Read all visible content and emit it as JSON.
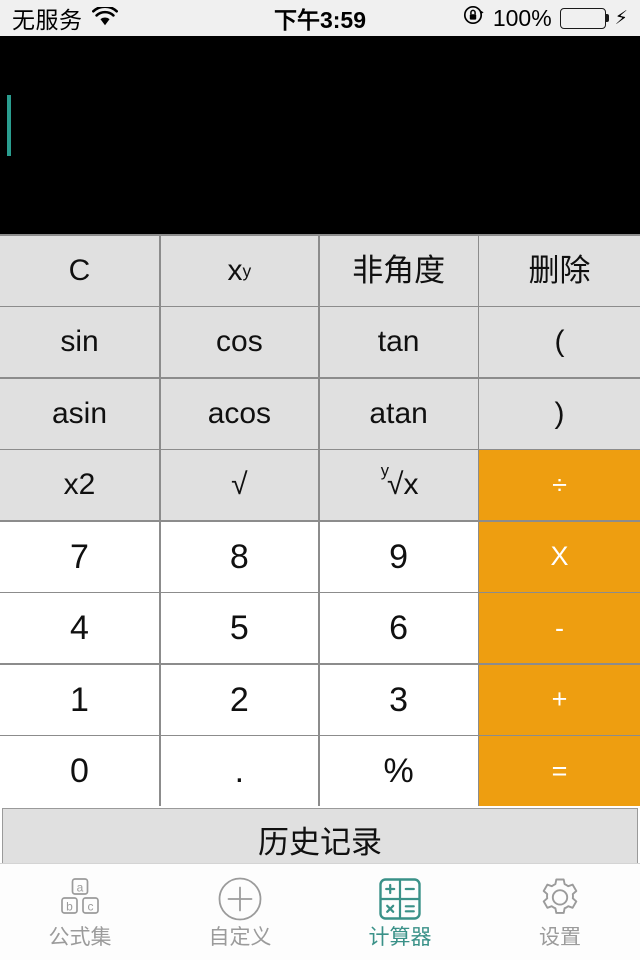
{
  "status_bar": {
    "carrier": "无服务",
    "wifi_icon": "wifi-icon",
    "time": "下午3:59",
    "rotation_lock_icon": "rotation-lock-icon",
    "battery_percent": "100%",
    "battery_icon": "battery-icon",
    "charging_icon": "lightning-bolt-icon",
    "battery_color": "#4cd964"
  },
  "display": {
    "value": "",
    "caret_color": "#2a9d8f",
    "background": "#000000"
  },
  "keypad": {
    "function_key_color": "#e0e0e0",
    "number_key_color": "#ffffff",
    "operator_key_color": "#ee9e10",
    "rows": [
      [
        {
          "label": "C",
          "name": "clear",
          "type": "fn"
        },
        {
          "label": "x",
          "sup": "y",
          "name": "power",
          "type": "fn"
        },
        {
          "label": "非角度",
          "name": "angle-mode",
          "type": "cjk"
        },
        {
          "label": "删除",
          "name": "delete",
          "type": "cjk"
        }
      ],
      [
        {
          "label": "sin",
          "name": "sin",
          "type": "fn"
        },
        {
          "label": "cos",
          "name": "cos",
          "type": "fn"
        },
        {
          "label": "tan",
          "name": "tan",
          "type": "fn"
        },
        {
          "label": "(",
          "name": "open-paren",
          "type": "fn"
        }
      ],
      [
        {
          "label": "asin",
          "name": "asin",
          "type": "fn"
        },
        {
          "label": "acos",
          "name": "acos",
          "type": "fn"
        },
        {
          "label": "atan",
          "name": "atan",
          "type": "fn"
        },
        {
          "label": ")",
          "name": "close-paren",
          "type": "fn"
        }
      ],
      [
        {
          "label": "x2",
          "name": "square",
          "type": "fn"
        },
        {
          "label": "√",
          "name": "square-root",
          "type": "fn"
        },
        {
          "label": "√x",
          "radix": "y",
          "name": "nth-root",
          "type": "fn"
        },
        {
          "label": "÷",
          "name": "divide",
          "type": "op"
        }
      ],
      [
        {
          "label": "7",
          "name": "digit-7",
          "type": "num"
        },
        {
          "label": "8",
          "name": "digit-8",
          "type": "num"
        },
        {
          "label": "9",
          "name": "digit-9",
          "type": "num"
        },
        {
          "label": "X",
          "name": "multiply",
          "type": "op"
        }
      ],
      [
        {
          "label": "4",
          "name": "digit-4",
          "type": "num"
        },
        {
          "label": "5",
          "name": "digit-5",
          "type": "num"
        },
        {
          "label": "6",
          "name": "digit-6",
          "type": "num"
        },
        {
          "label": "-",
          "name": "subtract",
          "type": "op"
        }
      ],
      [
        {
          "label": "1",
          "name": "digit-1",
          "type": "num"
        },
        {
          "label": "2",
          "name": "digit-2",
          "type": "num"
        },
        {
          "label": "3",
          "name": "digit-3",
          "type": "num"
        },
        {
          "label": "+",
          "name": "add",
          "type": "op"
        }
      ],
      [
        {
          "label": "0",
          "name": "digit-0",
          "type": "num"
        },
        {
          "label": ".",
          "name": "decimal-point",
          "type": "num"
        },
        {
          "label": "%",
          "name": "percent",
          "type": "num"
        },
        {
          "label": "=",
          "name": "equals",
          "type": "op"
        }
      ]
    ]
  },
  "history_button": {
    "label": "历史记录"
  },
  "tab_bar": {
    "active_color": "#3a9188",
    "inactive_color": "#9b9b9b",
    "tabs": [
      {
        "label": "公式集",
        "icon": "blocks-abc-icon",
        "name": "tab-formulas",
        "active": false
      },
      {
        "label": "自定义",
        "icon": "circle-plus-icon",
        "name": "tab-custom",
        "active": false
      },
      {
        "label": "计算器",
        "icon": "calculator-grid-icon",
        "name": "tab-calculator",
        "active": true
      },
      {
        "label": "设置",
        "icon": "gear-icon",
        "name": "tab-settings",
        "active": false
      }
    ]
  },
  "blocks_icon_letters": {
    "top": "a",
    "left": "b",
    "right": "c"
  },
  "calc_icon_symbols": {
    "tl": "+",
    "tr": "−",
    "bl": "×",
    "br": "="
  }
}
